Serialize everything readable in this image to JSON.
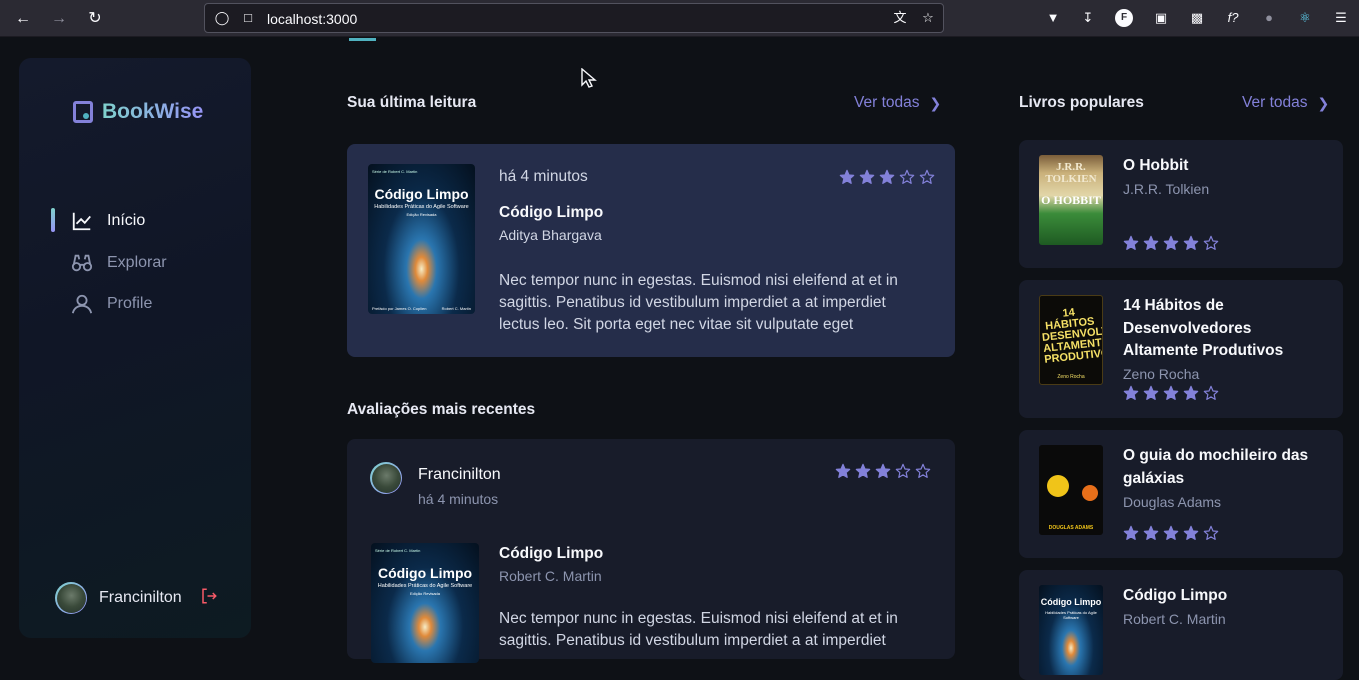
{
  "browser": {
    "url": "localhost:3000",
    "ext_profile_letter": "F"
  },
  "app": {
    "name": "BookWise"
  },
  "sidebar": {
    "items": [
      {
        "label": "Início",
        "icon": "chart-line-icon",
        "active": true
      },
      {
        "label": "Explorar",
        "icon": "binoculars-icon",
        "active": false
      },
      {
        "label": "Profile",
        "icon": "user-icon",
        "active": false
      }
    ],
    "user_name": "Francinilton"
  },
  "last_read": {
    "section_title": "Sua última leitura",
    "see_all": "Ver todas",
    "time": "há 4 minutos",
    "rating": 3,
    "title": "Código Limpo",
    "author": "Aditya Bhargava",
    "description": "Nec tempor nunc in egestas. Euismod nisi eleifend at et in sagittis. Penatibus id vestibulum imperdiet a at imperdiet lectus leo. Sit porta eget nec vitae sit vulputate eget",
    "cover": {
      "series": "Série de Robert C. Martin",
      "title": "Código Limpo",
      "subtitle": "Habilidades Práticas do Agile Software",
      "edition": "Edição Revisada",
      "preface": "Prefácio por James O. Coplien",
      "author": "Robert C. Martin"
    }
  },
  "recent": {
    "section_title": "Avaliações mais recentes",
    "user_name": "Francinilton",
    "time": "há 4 minutos",
    "rating": 3,
    "title": "Código Limpo",
    "author": "Robert C. Martin",
    "description": "Nec tempor nunc in egestas. Euismod nisi eleifend at et in sagittis. Penatibus id vestibulum imperdiet a at imperdiet"
  },
  "popular": {
    "section_title": "Livros populares",
    "see_all": "Ver todas",
    "books": [
      {
        "title": "O Hobbit",
        "author": "J.R.R. Tolkien",
        "rating": 4,
        "cover_top": "J.R.R. TOLKIEN",
        "cover_title": "O HOBBIT"
      },
      {
        "title": "14 Hábitos de Desenvolvedores Altamente Produtivos",
        "author": "Zeno Rocha",
        "rating": 4,
        "cover_title": "14 HÁBITOS DESENVOLVEDORES ALTAMENTE PRODUTIVOS",
        "cover_author": "Zeno Rocha"
      },
      {
        "title": "O guia do mochileiro das galáxias",
        "author": "Douglas Adams",
        "rating": 4,
        "cover_author": "DOUGLAS ADAMS"
      },
      {
        "title": "Código Limpo",
        "author": "Robert C. Martin",
        "rating": 0
      }
    ]
  },
  "colors": {
    "accent": "#8381d9",
    "star": "#8381d9",
    "logout": "#f75a68"
  }
}
